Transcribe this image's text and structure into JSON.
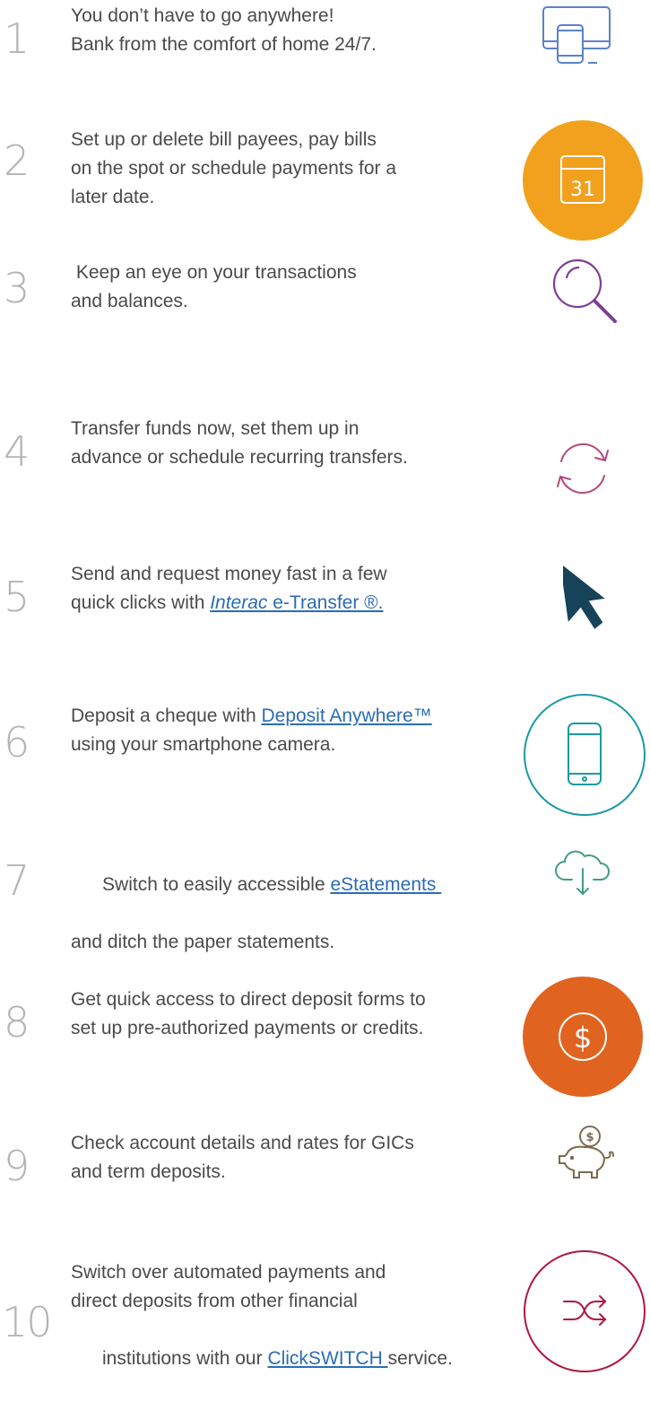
{
  "features": [
    {
      "number": "1",
      "line1": "You don’t have to go anywhere!",
      "line2": "Bank from the comfort of home 24/7."
    },
    {
      "number": "2",
      "line1": "Set up or delete bill payees, pay bills",
      "line2": "on the spot or schedule payments for a",
      "line3": "later date.",
      "icon_text": "31"
    },
    {
      "number": "3",
      "line1": " Keep an eye on your transactions",
      "line2": "and balances."
    },
    {
      "number": "4",
      "line1": "Transfer funds now, set them up in",
      "line2": "advance or schedule recurring transfers."
    },
    {
      "number": "5",
      "line1": "Send and request money fast in a few",
      "line2_pre": "quick clicks with ",
      "link_italic": "Interac",
      "link_rest": " e-Transfer ®."
    },
    {
      "number": "6",
      "line1_pre": "Deposit a cheque with ",
      "link": "Deposit Anywhere™",
      "line2": "using your smartphone camera."
    },
    {
      "number": "7",
      "line1_pre": "Switch to easily accessible ",
      "link": "eStatements ",
      "line2": "and ditch the paper statements."
    },
    {
      "number": "8",
      "line1": "Get quick access to direct deposit forms to",
      "line2": "set up pre-authorized payments or credits.",
      "icon_text": "$"
    },
    {
      "number": "9",
      "line1": "Check account details and rates for GICs",
      "line2": "and term deposits.",
      "icon_text": "$"
    },
    {
      "number": "10",
      "line1": "Switch over automated payments and",
      "line2": "direct deposits from other financial",
      "line3_pre": "institutions with our ",
      "link": "ClickSWITCH ",
      "line3_post": "service."
    }
  ],
  "icons": [
    "devices-icon",
    "calendar-icon",
    "magnifier-icon",
    "refresh-icon",
    "cursor-icon",
    "smartphone-icon",
    "cloud-download-icon",
    "dollar-icon",
    "piggy-bank-icon",
    "shuffle-icon"
  ],
  "colors": {
    "number_gray": "#b4b4b4",
    "text": "#4a4a4a",
    "link": "#2b6cb4",
    "devices_blue": "#5b83c7",
    "calendar_orange": "#f1a11e",
    "magnifier_purple": "#7d3f98",
    "refresh_pink": "#b4487a",
    "cursor_navy": "#16435a",
    "phone_teal": "#1a9aa2",
    "cloud_green": "#3f9e82",
    "dollar_orange": "#e06420",
    "piggy_brown": "#7a6b4f",
    "shuffle_crimson": "#b0173f"
  }
}
